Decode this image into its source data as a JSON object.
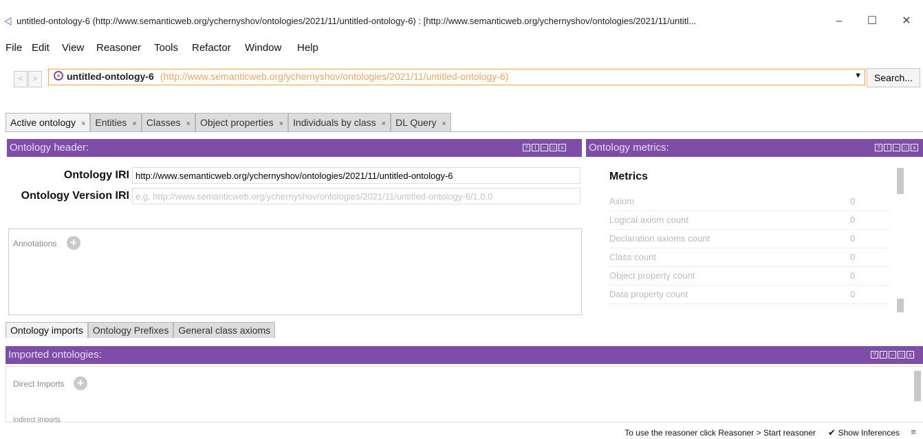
{
  "window": {
    "title": "untitled-ontology-6 (http://www.semanticweb.org/ychernyshov/ontologies/2021/11/untitled-ontology-6)  : [http://www.semanticweb.org/ychernyshov/ontologies/2021/11/untitl...",
    "minimize": "–",
    "maximize": "☐",
    "close": "✕"
  },
  "menu": [
    "File",
    "Edit",
    "View",
    "Reasoner",
    "Tools",
    "Refactor",
    "Window",
    "Help"
  ],
  "nav": {
    "back": "<",
    "forward": ">",
    "ontology_name": "untitled-ontology-6",
    "ontology_iri": "(http://www.semanticweb.org/ychernyshov/ontologies/2021/11/untitled-ontology-6)",
    "dropdown": "▼",
    "search_label": "Search..."
  },
  "tabs": [
    {
      "label": "Active ontology",
      "close": "×"
    },
    {
      "label": "Entities",
      "close": "×"
    },
    {
      "label": "Classes",
      "close": "×"
    },
    {
      "label": "Object properties",
      "close": "×"
    },
    {
      "label": "Individuals by class",
      "close": "×"
    },
    {
      "label": "DL Query",
      "close": "×"
    }
  ],
  "header_panel": {
    "title": "Ontology header:",
    "iri_label": "Ontology IRI",
    "iri_value": "http://www.semanticweb.org/ychernyshov/ontologies/2021/11/untitled-ontology-6",
    "version_label": "Ontology Version IRI",
    "version_placeholder": "e.g. http://www.semanticweb.org/ychernyshov/ontologies/2021/11/untitled-ontology-6/1.0.0",
    "annotations_label": "Annotations"
  },
  "metrics_panel": {
    "title": "Ontology metrics:",
    "heading": "Metrics",
    "rows": [
      {
        "label": "Axiom",
        "value": "0"
      },
      {
        "label": "Logical axiom count",
        "value": "0"
      },
      {
        "label": "Declaration axioms count",
        "value": "0"
      },
      {
        "label": "Class count",
        "value": "0"
      },
      {
        "label": "Object property count",
        "value": "0"
      },
      {
        "label": "Data property count",
        "value": "0"
      }
    ]
  },
  "bottom_tabs": [
    "Ontology imports",
    "Ontology Prefixes",
    "General class axioms"
  ],
  "imports_panel": {
    "title": "Imported ontologies:",
    "direct_label": "Direct Imports",
    "indirect_label": "Indirect Imports"
  },
  "status": {
    "reasoner_hint": "To use the reasoner click Reasoner > Start reasoner",
    "show_inferences_checked": "✔",
    "show_inferences_label": "Show Inferences"
  },
  "panel_controls": [
    "?",
    "I",
    "–",
    "□",
    "x"
  ],
  "colors": {
    "panel_header": "#7d4da8",
    "ontology_box_border": "#f0a040",
    "iri_orange": "#e7a860"
  }
}
